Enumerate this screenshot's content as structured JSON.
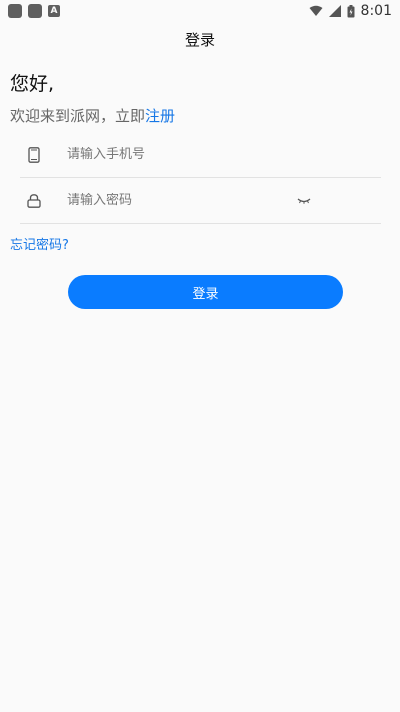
{
  "status_bar": {
    "notif_letter": "A",
    "time": "8:01"
  },
  "header": {
    "title": "登录"
  },
  "greeting": "您好,",
  "welcome": {
    "text": "欢迎来到派网，立即",
    "register_link": "注册"
  },
  "form": {
    "phone_placeholder": "请输入手机号",
    "password_placeholder": "请输入密码",
    "forgot_link": "忘记密码?",
    "login_label": "登录"
  },
  "colors": {
    "accent": "#0a7cff",
    "link": "#1677e6",
    "background": "#fafafa"
  },
  "icons": [
    "phone-icon",
    "lock-icon",
    "eye-closed-icon",
    "wifi-icon",
    "signal-icon",
    "battery-icon"
  ]
}
